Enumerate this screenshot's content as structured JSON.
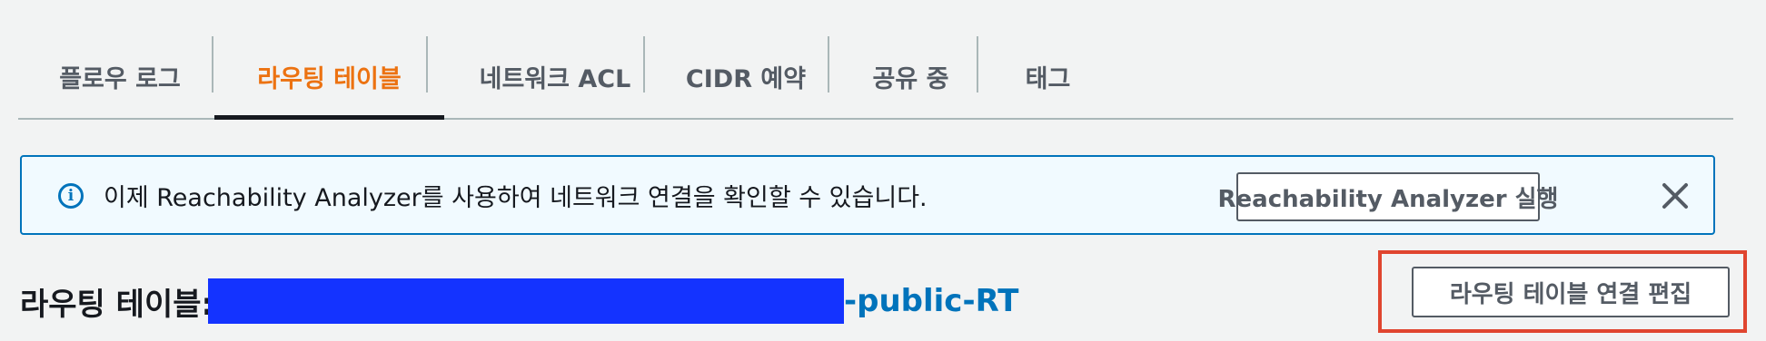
{
  "tabs": [
    {
      "label": "플로우 로그",
      "active": false
    },
    {
      "label": "라우팅 테이블",
      "active": true
    },
    {
      "label": "네트워크 ACL",
      "active": false
    },
    {
      "label": "CIDR 예약",
      "active": false
    },
    {
      "label": "공유 중",
      "active": false
    },
    {
      "label": "태그",
      "active": false
    }
  ],
  "banner": {
    "icon": "info-icon",
    "message": "이제 Reachability Analyzer를 사용하여 네트워크 연결을 확인할 수 있습니다.",
    "run_button_label": "Reachability Analyzer 실행",
    "close_icon": "close-icon"
  },
  "route_table": {
    "label": "라우팅 테이블:",
    "name_suffix": "-public-RT",
    "edit_button_label": "라우팅 테이블 연결 편집"
  },
  "colors": {
    "active_tab": "#ec7211",
    "link": "#0073bb",
    "highlight": "#e0452f",
    "redaction": "#1433ff"
  }
}
